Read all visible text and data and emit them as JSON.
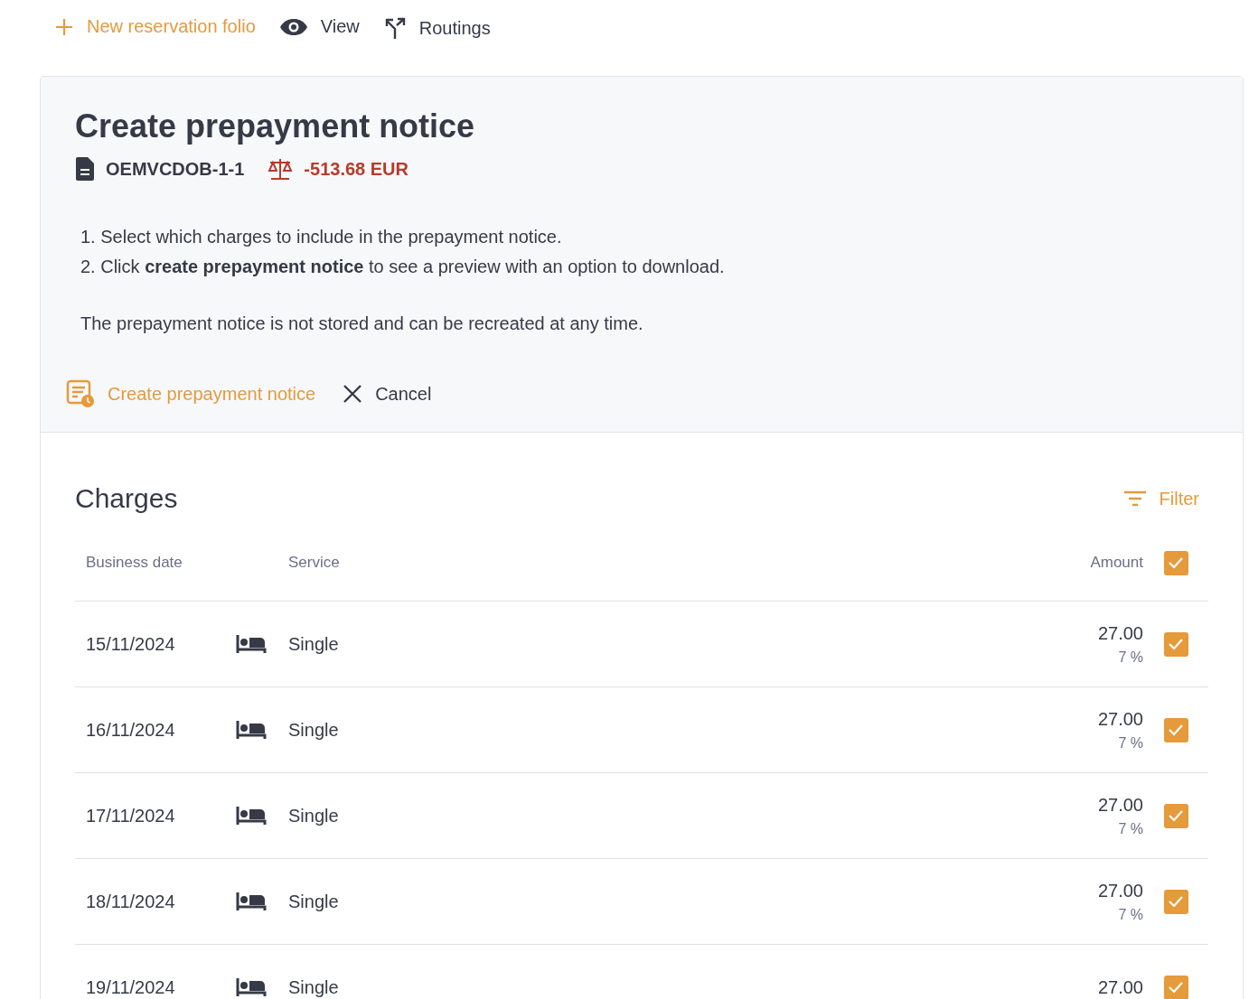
{
  "toolbar": [
    {
      "kind": "add",
      "label": "New reservation folio"
    },
    {
      "kind": "view",
      "label": "View"
    },
    {
      "kind": "routing",
      "label": "Routings"
    }
  ],
  "panel": {
    "title": "Create prepayment notice",
    "folio": "OEMVCDOB-1-1",
    "balance": "-513.68 EUR",
    "steps": [
      "1. Select which charges to include in the prepayment notice.",
      "2. Click **create prepayment notice** to see a preview with an option to download."
    ],
    "note": "The prepayment notice is not stored and can be recreated at any time.",
    "actions": [
      {
        "kind": "create",
        "label": "Create prepayment notice"
      },
      {
        "kind": "cancel",
        "label": "Cancel"
      }
    ]
  },
  "charges": {
    "title": "Charges",
    "filter": "Filter",
    "columns": [
      "Business date",
      "Service",
      "Amount"
    ],
    "all_checked": true,
    "rows": [
      {
        "date": "15/11/2024",
        "service": "Single",
        "amount": "27.00",
        "tax": "7 %",
        "checked": true
      },
      {
        "date": "16/11/2024",
        "service": "Single",
        "amount": "27.00",
        "tax": "7 %",
        "checked": true
      },
      {
        "date": "17/11/2024",
        "service": "Single",
        "amount": "27.00",
        "tax": "7 %",
        "checked": true
      },
      {
        "date": "18/11/2024",
        "service": "Single",
        "amount": "27.00",
        "tax": "7 %",
        "checked": true
      },
      {
        "date": "19/11/2024",
        "service": "Single",
        "amount": "27.00",
        "checked": true
      }
    ]
  }
}
